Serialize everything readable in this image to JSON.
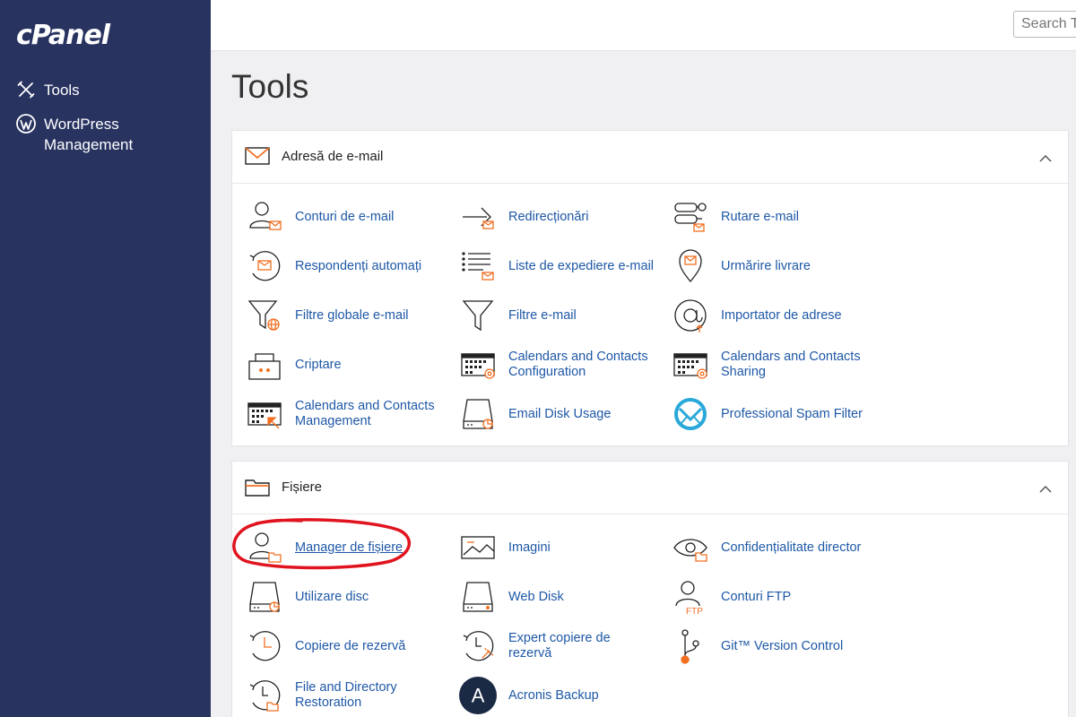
{
  "sidebar": {
    "logo": "cPanel",
    "items": [
      {
        "label": "Tools",
        "icon": "tools-icon"
      },
      {
        "label": "WordPress Management",
        "icon": "wordpress-icon"
      }
    ]
  },
  "topbar": {
    "search_placeholder": "Search Tools"
  },
  "page_title": "Tools",
  "sections": {
    "email": {
      "title": "Adresă de e-mail",
      "tools": [
        {
          "label": "Conturi de e-mail",
          "icon": "email-accounts-icon"
        },
        {
          "label": "Redirecționări",
          "icon": "forwarders-icon"
        },
        {
          "label": "Rutare e-mail",
          "icon": "email-routing-icon"
        },
        {
          "label": "Respondenți automați",
          "icon": "autoresponders-icon"
        },
        {
          "label": "Liste de expediere e-mail",
          "icon": "mailing-lists-icon"
        },
        {
          "label": "Urmărire livrare",
          "icon": "track-delivery-icon"
        },
        {
          "label": "Filtre globale e-mail",
          "icon": "global-filters-icon"
        },
        {
          "label": "Filtre e-mail",
          "icon": "email-filters-icon"
        },
        {
          "label": "Importator de adrese",
          "icon": "address-importer-icon"
        },
        {
          "label": "Criptare",
          "icon": "encryption-icon"
        },
        {
          "label": "Calendars and Contacts Configuration",
          "icon": "calendar-config-icon"
        },
        {
          "label": "Calendars and Contacts Sharing",
          "icon": "calendar-sharing-icon"
        },
        {
          "label": "Calendars and Contacts Management",
          "icon": "calendar-management-icon"
        },
        {
          "label": "Email Disk Usage",
          "icon": "email-disk-usage-icon"
        },
        {
          "label": "Professional Spam Filter",
          "icon": "spam-filter-icon"
        }
      ]
    },
    "files": {
      "title": "Fișiere",
      "tools": [
        {
          "label": "Manager de fișiere",
          "icon": "file-manager-icon"
        },
        {
          "label": "Imagini",
          "icon": "images-icon"
        },
        {
          "label": "Confidențialitate director",
          "icon": "directory-privacy-icon"
        },
        {
          "label": "Utilizare disc",
          "icon": "disk-usage-icon"
        },
        {
          "label": "Web Disk",
          "icon": "web-disk-icon"
        },
        {
          "label": "Conturi FTP",
          "icon": "ftp-accounts-icon"
        },
        {
          "label": "Copiere de rezervă",
          "icon": "backup-icon"
        },
        {
          "label": "Expert copiere de rezervă",
          "icon": "backup-wizard-icon"
        },
        {
          "label": "Git™ Version Control",
          "icon": "git-icon"
        },
        {
          "label": "File and Directory Restoration",
          "icon": "restoration-icon"
        },
        {
          "label": "Acronis Backup",
          "icon": "acronis-icon"
        }
      ]
    }
  },
  "icon_text": {
    "ftp": "FTP",
    "acronis": "A"
  },
  "colors": {
    "sidebar": "#283360",
    "link": "#1e58a6",
    "accent": "#f26f21",
    "spam": "#29a8d9",
    "acronis": "#1a2a44",
    "annotation": "#e0141e"
  }
}
